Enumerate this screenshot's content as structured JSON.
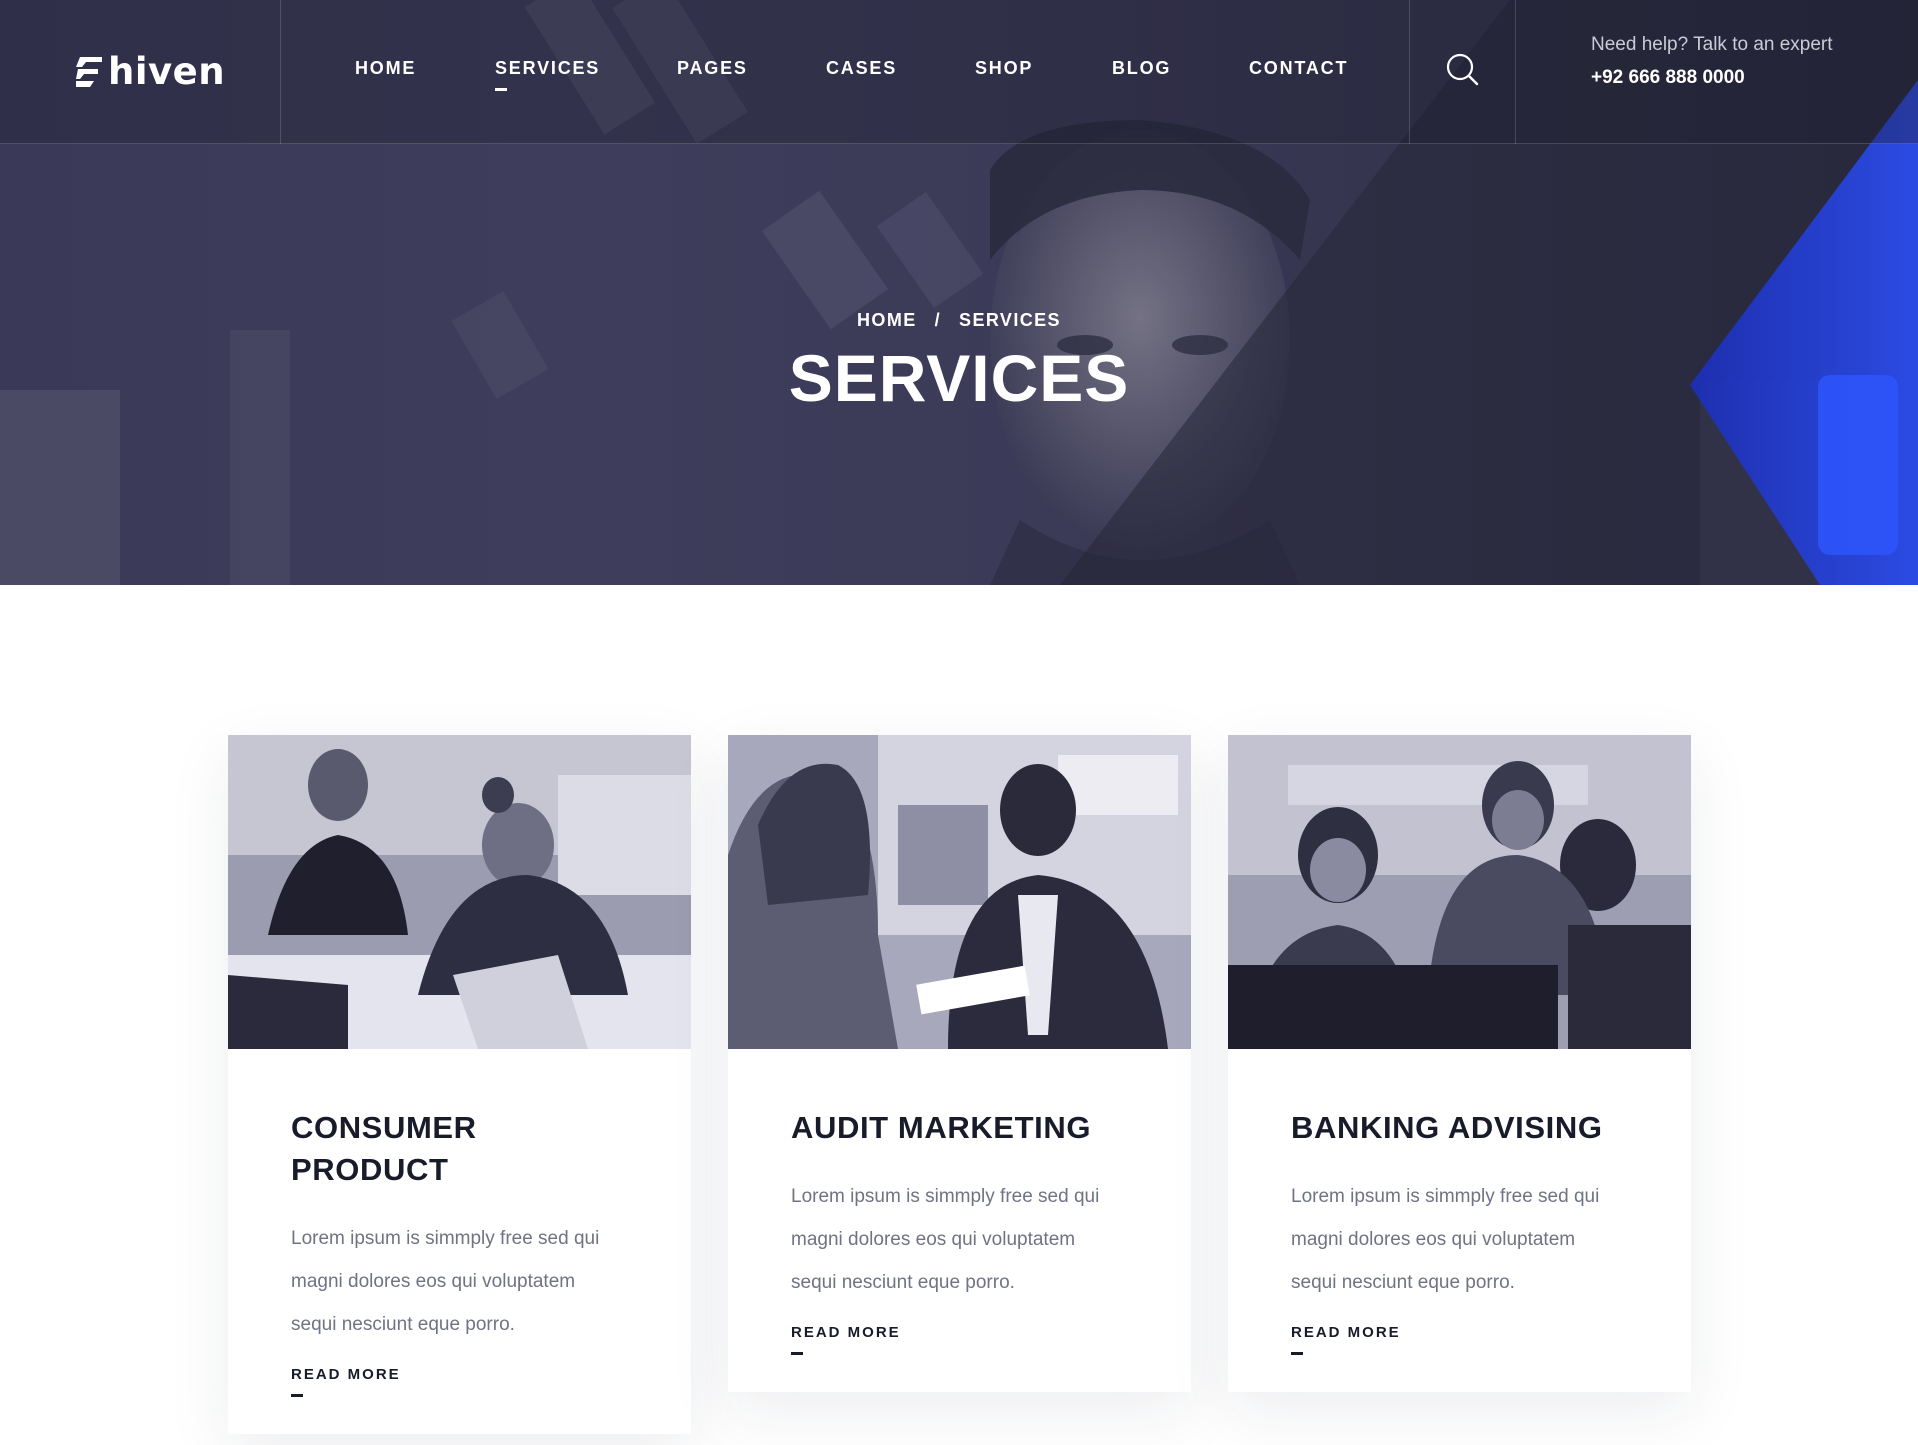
{
  "brand": {
    "name": "hiven",
    "accent": "#2447e8"
  },
  "nav": {
    "items": [
      {
        "label": "HOME",
        "active": false
      },
      {
        "label": "SERVICES",
        "active": true
      },
      {
        "label": "PAGES",
        "active": false
      },
      {
        "label": "CASES",
        "active": false
      },
      {
        "label": "SHOP",
        "active": false
      },
      {
        "label": "BLOG",
        "active": false
      },
      {
        "label": "CONTACT",
        "active": false
      }
    ],
    "search_icon": "search-icon"
  },
  "help": {
    "label": "Need help? Talk to an expert",
    "phone": "+92 666 888 0000"
  },
  "hero": {
    "breadcrumb": {
      "home": "HOME",
      "separator": "/",
      "current": "SERVICES"
    },
    "title": "SERVICES"
  },
  "cards": [
    {
      "title_line1": "CONSUMER",
      "title_line2": "PRODUCT",
      "text_line1": "Lorem ipsum is simmply free sed qui",
      "text_line2": "magni dolores eos qui voluptatem",
      "text_line3": "sequi nesciunt eque porro.",
      "link": "READ MORE"
    },
    {
      "title_line1": "AUDIT MARKETING",
      "title_line2": "",
      "text_line1": "Lorem ipsum is simmply free sed qui",
      "text_line2": "magni dolores eos qui voluptatem",
      "text_line3": "sequi nesciunt eque porro.",
      "link": "READ MORE"
    },
    {
      "title_line1": "BANKING ADVISING",
      "title_line2": "",
      "text_line1": "Lorem ipsum is simmply free sed qui",
      "text_line2": "magni dolores eos qui voluptatem",
      "text_line3": "sequi nesciunt eque porro.",
      "link": "READ MORE"
    }
  ]
}
